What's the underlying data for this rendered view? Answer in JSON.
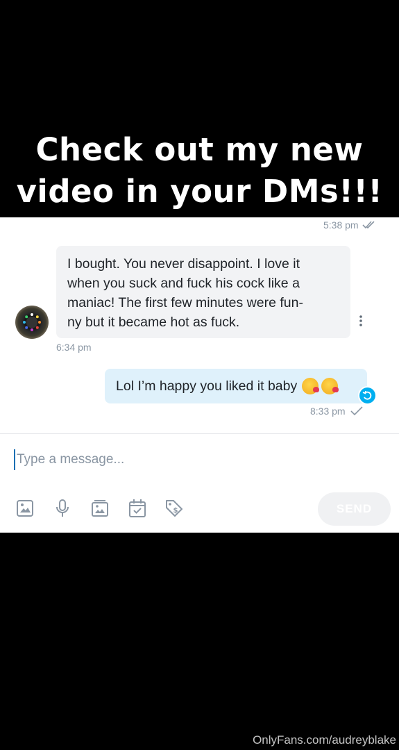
{
  "headline": {
    "line1": "Check out my new",
    "line2": "video in your DMs!!!"
  },
  "chat": {
    "top_timestamp": "5:38 pm",
    "incoming": {
      "line1": "I bought. You never disappoint. I love it",
      "line2": "when you suck and fuck his cock like a",
      "line3": "maniac! The first few minutes were fun-",
      "line4": "ny but it became hot as fuck.",
      "time": "6:34 pm"
    },
    "outgoing": {
      "text": "Lol I’m happy you liked it baby",
      "time": "8:33 pm"
    }
  },
  "composer": {
    "placeholder": "Type a message...",
    "send_label": "SEND"
  },
  "icons": {
    "tools": [
      "image-icon",
      "microphone-icon",
      "gallery-icon",
      "calendar-check-icon",
      "price-tag-icon"
    ],
    "accent": "#00aff0",
    "icon_color": "#8a96a3"
  },
  "watermark": "OnlyFans.com/audreyblake"
}
